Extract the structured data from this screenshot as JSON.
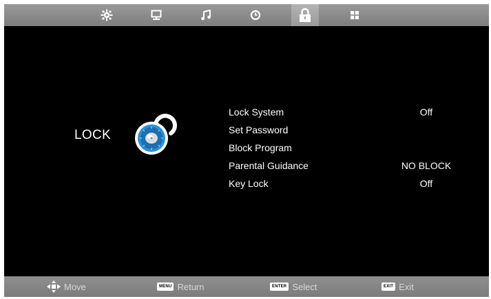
{
  "top_tabs": [
    {
      "icon": "picture-settings-icon",
      "active": false
    },
    {
      "icon": "monitor-icon",
      "active": false
    },
    {
      "icon": "music-note-icon",
      "active": false
    },
    {
      "icon": "clock-icon",
      "active": false
    },
    {
      "icon": "lock-icon",
      "active": true
    },
    {
      "icon": "setup-grid-icon",
      "active": false
    }
  ],
  "section": {
    "title": "LOCK"
  },
  "menu": [
    {
      "label": "Lock System",
      "value": "Off"
    },
    {
      "label": "Set Password",
      "value": ""
    },
    {
      "label": "Block Program",
      "value": ""
    },
    {
      "label": "Parental Guidance",
      "value": "NO BLOCK"
    },
    {
      "label": "Key Lock",
      "value": "Off"
    }
  ],
  "bottom_hints": {
    "move": {
      "label": "Move"
    },
    "return": {
      "key": "MENU",
      "label": "Return"
    },
    "select": {
      "key": "ENTER",
      "label": "Select"
    },
    "exit": {
      "key": "EXIT",
      "label": "Exit"
    }
  },
  "colors": {
    "background": "#000000",
    "bar": "#8a8a8a",
    "accent_blue": "#2a8fd6"
  }
}
